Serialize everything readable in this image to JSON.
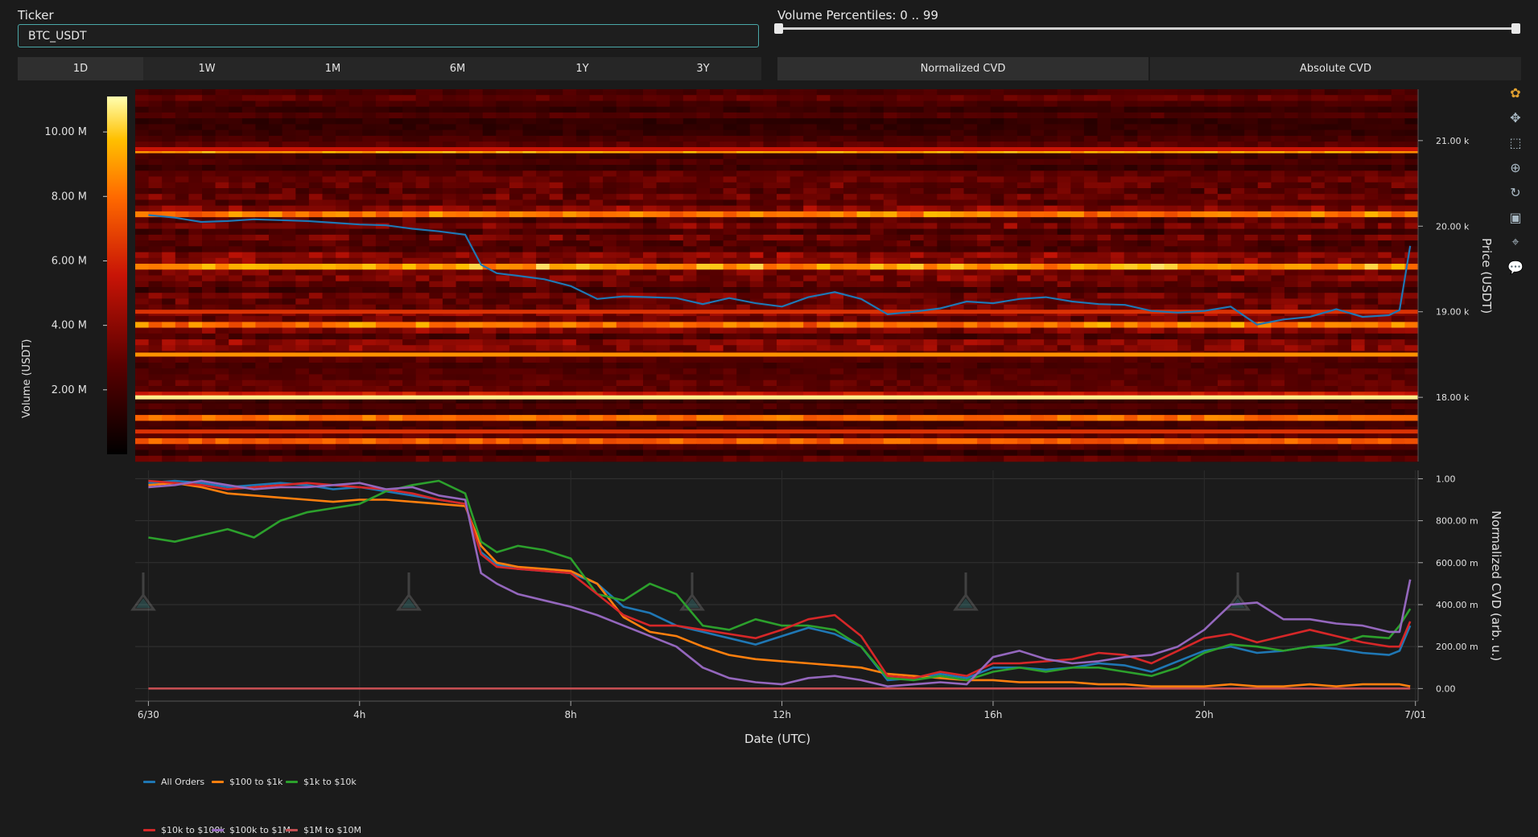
{
  "ticker": {
    "label": "Ticker",
    "value": "BTC_USDT"
  },
  "volume_percentiles": {
    "label": "Volume Percentiles: 0 .. 99",
    "min": 0,
    "max": 99
  },
  "timeframes": [
    "1D",
    "1W",
    "1M",
    "6M",
    "1Y",
    "3Y"
  ],
  "timeframe_active": "1D",
  "cvd_modes": [
    "Normalized CVD",
    "Absolute CVD"
  ],
  "cvd_mode_active": "Normalized CVD",
  "toolbar": [
    "logo-icon",
    "pan-icon",
    "box-zoom-icon",
    "wheel-zoom-icon",
    "reset-icon",
    "save-icon",
    "crosshair-icon",
    "hover-icon"
  ],
  "heatmap": {
    "colorbar_title": "Volume (USDT)",
    "colorbar_ticks": [
      "10.00 M",
      "8.00 M",
      "6.00 M",
      "4.00 M",
      "2.00 M"
    ],
    "colorbar_tick_values": [
      10,
      8,
      6,
      4,
      2
    ],
    "colorbar_max": 11.1,
    "price_axis_title": "Price (USDT)",
    "price_ticks": [
      "21.00 k",
      "20.00 k",
      "19.00 k",
      "18.00 k"
    ],
    "price_tick_values": [
      21000,
      20000,
      19000,
      18000
    ],
    "price_range": [
      17250,
      21600
    ],
    "price_line": {
      "color": "#1f77b4",
      "x": [
        0,
        0.5,
        1,
        1.5,
        2,
        2.5,
        3,
        3.5,
        4,
        4.5,
        5,
        5.5,
        6,
        6.3,
        6.6,
        7,
        7.5,
        8,
        8.5,
        9,
        9.5,
        10,
        10.5,
        11,
        11.5,
        12,
        12.5,
        13,
        13.5,
        14,
        14.5,
        15,
        15.5,
        16,
        16.5,
        17,
        17.5,
        18,
        18.5,
        19,
        19.5,
        20,
        20.5,
        21,
        21.5,
        22,
        22.5,
        23,
        23.5,
        23.7,
        23.9
      ],
      "y": [
        20130,
        20100,
        20050,
        20060,
        20080,
        20070,
        20060,
        20040,
        20020,
        20010,
        19970,
        19940,
        19900,
        19550,
        19450,
        19420,
        19380,
        19300,
        19150,
        19180,
        19170,
        19160,
        19090,
        19160,
        19100,
        19060,
        19170,
        19230,
        19150,
        18970,
        19000,
        19040,
        19120,
        19100,
        19150,
        19170,
        19120,
        19090,
        19080,
        19010,
        18990,
        19010,
        19060,
        18850,
        18910,
        18940,
        19030,
        18940,
        18960,
        19020,
        19770
      ]
    }
  },
  "cvd": {
    "y_axis_title": "Normalized CVD (arb. u.)",
    "y_ticks": [
      "1.00",
      "800.00 m",
      "600.00 m",
      "400.00 m",
      "200.00 m",
      "0.00"
    ],
    "y_tick_values": [
      1,
      0.8,
      0.6,
      0.4,
      0.2,
      0
    ],
    "y_range": [
      -0.06,
      1.04
    ],
    "x_axis_title": "Date (UTC)",
    "x_ticks": [
      "6/30",
      "4h",
      "8h",
      "12h",
      "16h",
      "20h",
      "7/01"
    ],
    "x_tick_values": [
      0,
      4,
      8,
      12,
      16,
      20,
      24
    ],
    "x_range": [
      -0.25,
      24.05
    ]
  },
  "chart_data": {
    "type": "line",
    "title": "",
    "xlabel": "Date (UTC)",
    "ylabel": "Normalized CVD (arb. u.)",
    "ylim": [
      0,
      1
    ],
    "x": [
      0,
      0.5,
      1,
      1.5,
      2,
      2.5,
      3,
      3.5,
      4,
      4.5,
      5,
      5.5,
      6,
      6.3,
      6.6,
      7,
      7.5,
      8,
      8.5,
      9,
      9.5,
      10,
      10.5,
      11,
      11.5,
      12,
      12.5,
      13,
      13.5,
      14,
      14.5,
      15,
      15.5,
      16,
      16.5,
      17,
      17.5,
      18,
      18.5,
      19,
      19.5,
      20,
      20.5,
      21,
      21.5,
      22,
      22.5,
      23,
      23.5,
      23.7,
      23.9
    ],
    "series": [
      {
        "name": "All Orders",
        "color": "#1f77b4",
        "values": [
          0.98,
          0.99,
          0.98,
          0.96,
          0.97,
          0.98,
          0.97,
          0.95,
          0.96,
          0.94,
          0.92,
          0.9,
          0.88,
          0.65,
          0.59,
          0.57,
          0.56,
          0.55,
          0.5,
          0.39,
          0.36,
          0.3,
          0.27,
          0.24,
          0.21,
          0.25,
          0.29,
          0.26,
          0.2,
          0.04,
          0.05,
          0.07,
          0.05,
          0.1,
          0.1,
          0.09,
          0.1,
          0.12,
          0.11,
          0.08,
          0.13,
          0.18,
          0.2,
          0.17,
          0.18,
          0.2,
          0.19,
          0.17,
          0.16,
          0.18,
          0.3
        ]
      },
      {
        "name": "$100 to $1k",
        "color": "#ff7f0e",
        "values": [
          0.97,
          0.98,
          0.96,
          0.93,
          0.92,
          0.91,
          0.9,
          0.89,
          0.9,
          0.9,
          0.89,
          0.88,
          0.87,
          0.68,
          0.6,
          0.58,
          0.57,
          0.56,
          0.5,
          0.34,
          0.27,
          0.25,
          0.2,
          0.16,
          0.14,
          0.13,
          0.12,
          0.11,
          0.1,
          0.07,
          0.06,
          0.05,
          0.04,
          0.04,
          0.03,
          0.03,
          0.03,
          0.02,
          0.02,
          0.01,
          0.01,
          0.01,
          0.02,
          0.01,
          0.01,
          0.02,
          0.01,
          0.02,
          0.02,
          0.02,
          0.01
        ]
      },
      {
        "name": "$1k to $10k",
        "color": "#2ca02c",
        "values": [
          0.72,
          0.7,
          0.73,
          0.76,
          0.72,
          0.8,
          0.84,
          0.86,
          0.88,
          0.94,
          0.97,
          0.99,
          0.93,
          0.7,
          0.65,
          0.68,
          0.66,
          0.62,
          0.45,
          0.42,
          0.5,
          0.45,
          0.3,
          0.28,
          0.33,
          0.3,
          0.3,
          0.28,
          0.2,
          0.05,
          0.04,
          0.06,
          0.04,
          0.08,
          0.1,
          0.08,
          0.1,
          0.1,
          0.08,
          0.06,
          0.1,
          0.17,
          0.21,
          0.2,
          0.18,
          0.2,
          0.21,
          0.25,
          0.24,
          0.3,
          0.38
        ]
      },
      {
        "name": "$10k to $100k",
        "color": "#d62728",
        "values": [
          0.99,
          0.98,
          0.97,
          0.95,
          0.96,
          0.97,
          0.98,
          0.97,
          0.96,
          0.95,
          0.93,
          0.9,
          0.88,
          0.64,
          0.58,
          0.57,
          0.56,
          0.55,
          0.45,
          0.35,
          0.3,
          0.3,
          0.28,
          0.26,
          0.24,
          0.28,
          0.33,
          0.35,
          0.25,
          0.06,
          0.05,
          0.08,
          0.06,
          0.12,
          0.12,
          0.13,
          0.14,
          0.17,
          0.16,
          0.12,
          0.18,
          0.24,
          0.26,
          0.22,
          0.25,
          0.28,
          0.25,
          0.22,
          0.2,
          0.2,
          0.32
        ]
      },
      {
        "name": "$100k to $1M",
        "color": "#9467bd",
        "values": [
          0.96,
          0.97,
          0.99,
          0.97,
          0.95,
          0.96,
          0.96,
          0.97,
          0.98,
          0.95,
          0.96,
          0.92,
          0.9,
          0.55,
          0.5,
          0.45,
          0.42,
          0.39,
          0.35,
          0.3,
          0.25,
          0.2,
          0.1,
          0.05,
          0.03,
          0.02,
          0.05,
          0.06,
          0.04,
          0.01,
          0.02,
          0.03,
          0.02,
          0.15,
          0.18,
          0.14,
          0.12,
          0.13,
          0.15,
          0.16,
          0.2,
          0.28,
          0.4,
          0.41,
          0.33,
          0.33,
          0.31,
          0.3,
          0.27,
          0.27,
          0.52
        ]
      },
      {
        "name": "$1M to $10M",
        "color": "#c44e52",
        "values": [
          0.0,
          0.0,
          0.0,
          0.0,
          0.0,
          0.0,
          0.0,
          0.0,
          0.0,
          0.0,
          0.0,
          0.0,
          0.0,
          0.0,
          0.0,
          0.0,
          0.0,
          0.0,
          0.0,
          0.0,
          0.0,
          0.0,
          0.0,
          0.0,
          0.0,
          0.0,
          0.0,
          0.0,
          0.0,
          0.0,
          0.0,
          0.0,
          0.0,
          0.0,
          0.0,
          0.0,
          0.0,
          0.0,
          0.0,
          0.0,
          0.0,
          0.0,
          0.0,
          0.0,
          0.0,
          0.0,
          0.0,
          0.0,
          0.0,
          0.0,
          0.0
        ]
      }
    ]
  }
}
